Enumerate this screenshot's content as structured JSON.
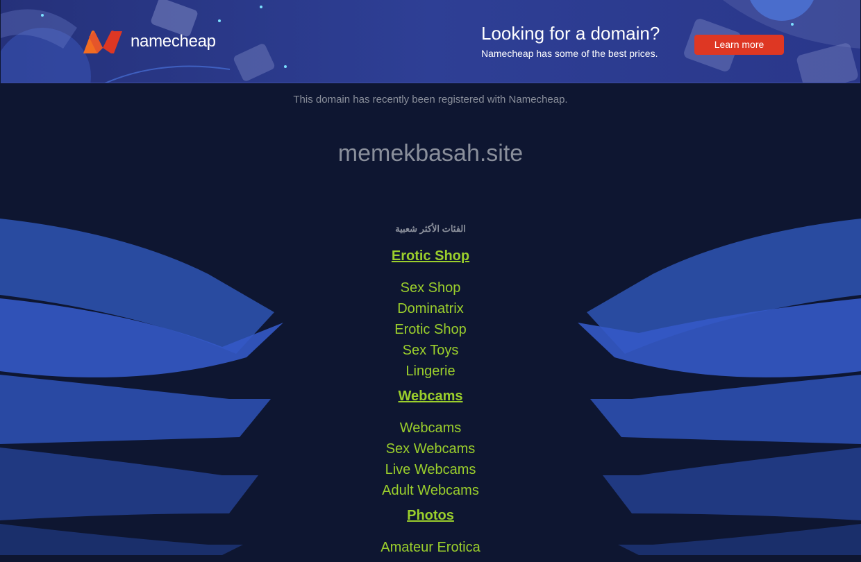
{
  "banner": {
    "brand_name": "namecheap",
    "headline": "Looking for a domain?",
    "subline": "Namecheap has some of the best prices.",
    "button_label": "Learn more",
    "accent_color": "#de3723",
    "logo_colors": [
      "#f26d21",
      "#de3723"
    ]
  },
  "page": {
    "registered_text": "This domain has recently been registered with Namecheap.",
    "domain_name": "memekbasah.site",
    "popular_label": "الفئات الأكثر شعبية",
    "link_color": "#9bcf2c"
  },
  "categories": [
    {
      "title": "Erotic Shop",
      "links": [
        "Sex Shop",
        "Dominatrix",
        "Erotic Shop",
        "Sex Toys",
        "Lingerie"
      ]
    },
    {
      "title": "Webcams",
      "links": [
        "Webcams",
        "Sex Webcams",
        "Live Webcams",
        "Adult Webcams"
      ]
    },
    {
      "title": "Photos",
      "links": [
        "Amateur Erotica"
      ]
    }
  ]
}
